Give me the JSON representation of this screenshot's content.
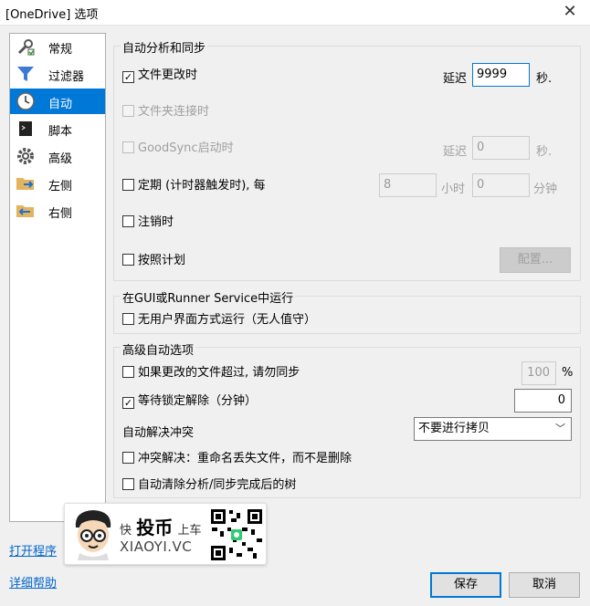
{
  "window": {
    "title": "[OneDrive] 选项",
    "close_glyph": "✕"
  },
  "sidebar": {
    "items": [
      {
        "label": "常规",
        "icon": "wrench-icon"
      },
      {
        "label": "过滤器",
        "icon": "filter-icon"
      },
      {
        "label": "自动",
        "icon": "clock-icon",
        "selected": true
      },
      {
        "label": "脚本",
        "icon": "terminal-icon"
      },
      {
        "label": "高级",
        "icon": "gear-icon"
      },
      {
        "label": "左侧",
        "icon": "folder-right-arrow-icon"
      },
      {
        "label": "右侧",
        "icon": "folder-left-arrow-icon"
      }
    ]
  },
  "auto_sync": {
    "title": "自动分析和同步",
    "file_changed": {
      "label": "文件更改时",
      "checked": true
    },
    "delay_label": "延迟",
    "delay_value": "9999",
    "seconds_label": "秒.",
    "folder_connect": {
      "label": "文件夹连接时",
      "checked": false,
      "disabled": true
    },
    "goodsync_start": {
      "label": "GoodSync启动时",
      "checked": false,
      "disabled": true
    },
    "delay2_label": "延迟",
    "delay2_value": "0",
    "seconds2_label": "秒.",
    "periodic": {
      "label": "定期 (计时器触发时), 每",
      "checked": false
    },
    "hours_value": "8",
    "hours_label": "小时",
    "minutes_value": "0",
    "minutes_label": "分钟",
    "logoff": {
      "label": "注销时",
      "checked": false
    },
    "schedule": {
      "label": "按照计划",
      "checked": false
    },
    "configure_button": "配置..."
  },
  "gui_runner": {
    "title": "在GUI或Runner Service中运行",
    "unattended": {
      "label": "无用户界面方式运行（无人值守）",
      "checked": false
    }
  },
  "advanced": {
    "title": "高级自动选项",
    "dont_sync_if_changed": {
      "label": "如果更改的文件超过, 请勿同步",
      "checked": false
    },
    "percent_value": "100",
    "percent_label": "%",
    "wait_unlock": {
      "label": "等待锁定解除（分钟）",
      "checked": true
    },
    "wait_value": "0",
    "auto_resolve_label": "自动解决冲突",
    "auto_resolve_value": "不要进行拷贝",
    "conflict_rename": {
      "label": "冲突解决：重命名丢失文件，而不是删除",
      "checked": false
    },
    "auto_clear": {
      "label": "自动清除分析/同步完成后的树",
      "checked": false
    }
  },
  "links": {
    "open_program": "打开程序",
    "detail_help": "详细帮助"
  },
  "buttons": {
    "save": "保存",
    "cancel": "取消"
  },
  "watermark": {
    "line1_small": "快",
    "line1_big": "投币",
    "line1_small2": "上车",
    "line2": "XIAOYI.VC"
  },
  "colors": {
    "accent": "#0078d7",
    "link": "#0066cc"
  }
}
